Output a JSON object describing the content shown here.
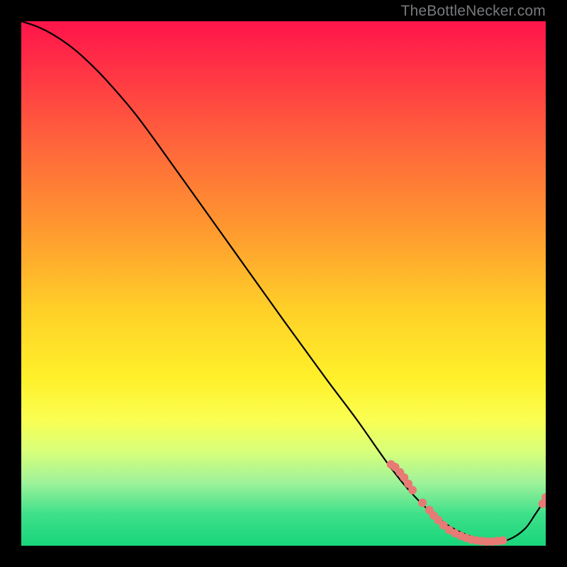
{
  "watermark": "TheBottleNecker.com",
  "dot_color": "#e77a74",
  "curve_color": "#000000",
  "chart_data": {
    "type": "line",
    "title": "",
    "xlabel": "",
    "ylabel": "",
    "xlim": [
      0,
      100
    ],
    "ylim": [
      0,
      100
    ],
    "series": [
      {
        "name": "curve",
        "x": [
          0,
          3,
          6,
          9,
          12,
          16,
          22,
          30,
          40,
          50,
          58,
          64,
          70,
          74,
          78,
          82,
          86,
          90,
          93,
          96,
          98,
          100
        ],
        "y": [
          100,
          99,
          97.5,
          95.5,
          93,
          89,
          82,
          71,
          57,
          43,
          32,
          24,
          15.5,
          10.5,
          6.5,
          3.5,
          1.7,
          0.8,
          1.2,
          3.2,
          6,
          9
        ]
      }
    ],
    "highlight_points": [
      {
        "x": 70.5,
        "y": 15.5
      },
      {
        "x": 71.3,
        "y": 15.0
      },
      {
        "x": 72.2,
        "y": 14.0
      },
      {
        "x": 73.0,
        "y": 13.0
      },
      {
        "x": 73.8,
        "y": 11.8
      },
      {
        "x": 74.6,
        "y": 10.6
      },
      {
        "x": 76.5,
        "y": 8.2
      },
      {
        "x": 77.8,
        "y": 6.8
      },
      {
        "x": 78.6,
        "y": 5.8
      },
      {
        "x": 79.5,
        "y": 4.9
      },
      {
        "x": 80.5,
        "y": 3.9
      },
      {
        "x": 81.6,
        "y": 3.0
      },
      {
        "x": 82.7,
        "y": 2.4
      },
      {
        "x": 83.8,
        "y": 1.9
      },
      {
        "x": 84.8,
        "y": 1.5
      },
      {
        "x": 85.8,
        "y": 1.2
      },
      {
        "x": 86.8,
        "y": 1.0
      },
      {
        "x": 87.8,
        "y": 0.9
      },
      {
        "x": 88.8,
        "y": 0.8
      },
      {
        "x": 89.8,
        "y": 0.8
      },
      {
        "x": 90.8,
        "y": 0.9
      },
      {
        "x": 91.8,
        "y": 1.0
      },
      {
        "x": 99.4,
        "y": 8.0
      },
      {
        "x": 100.0,
        "y": 9.2
      }
    ]
  }
}
